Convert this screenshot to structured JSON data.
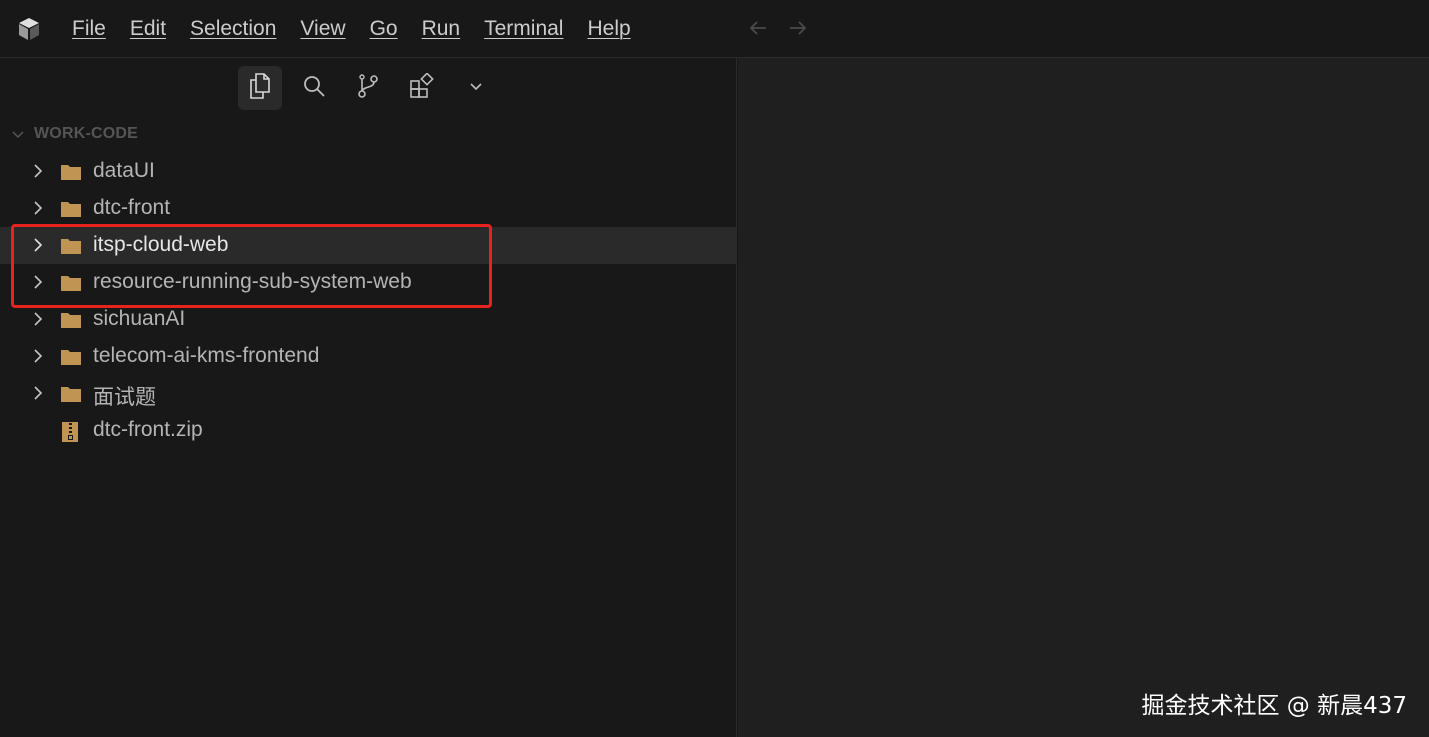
{
  "menu": {
    "items": [
      "File",
      "Edit",
      "Selection",
      "View",
      "Go",
      "Run",
      "Terminal",
      "Help"
    ]
  },
  "toolbar": {
    "buttons": [
      "explorer-icon",
      "search-icon",
      "source-control-icon",
      "extensions-icon",
      "chevron-down-icon"
    ]
  },
  "explorer": {
    "section_title": "WORK-CODE",
    "items": [
      {
        "label": "dataUI",
        "type": "folder"
      },
      {
        "label": "dtc-front",
        "type": "folder"
      },
      {
        "label": "itsp-cloud-web",
        "type": "folder",
        "selected": true
      },
      {
        "label": "resource-running-sub-system-web",
        "type": "folder"
      },
      {
        "label": "sichuanAI",
        "type": "folder"
      },
      {
        "label": "telecom-ai-kms-frontend",
        "type": "folder"
      },
      {
        "label": "面试题",
        "type": "folder"
      },
      {
        "label": "dtc-front.zip",
        "type": "zip-file"
      }
    ]
  },
  "annotation": {
    "highlight_color": "#e8231f"
  },
  "watermark": "掘金技术社区 @ 新晨437",
  "colors": {
    "background": "#181818",
    "editor_bg": "#1f1f1f",
    "folder": "#c09553",
    "selection": "#2a2a2a"
  }
}
